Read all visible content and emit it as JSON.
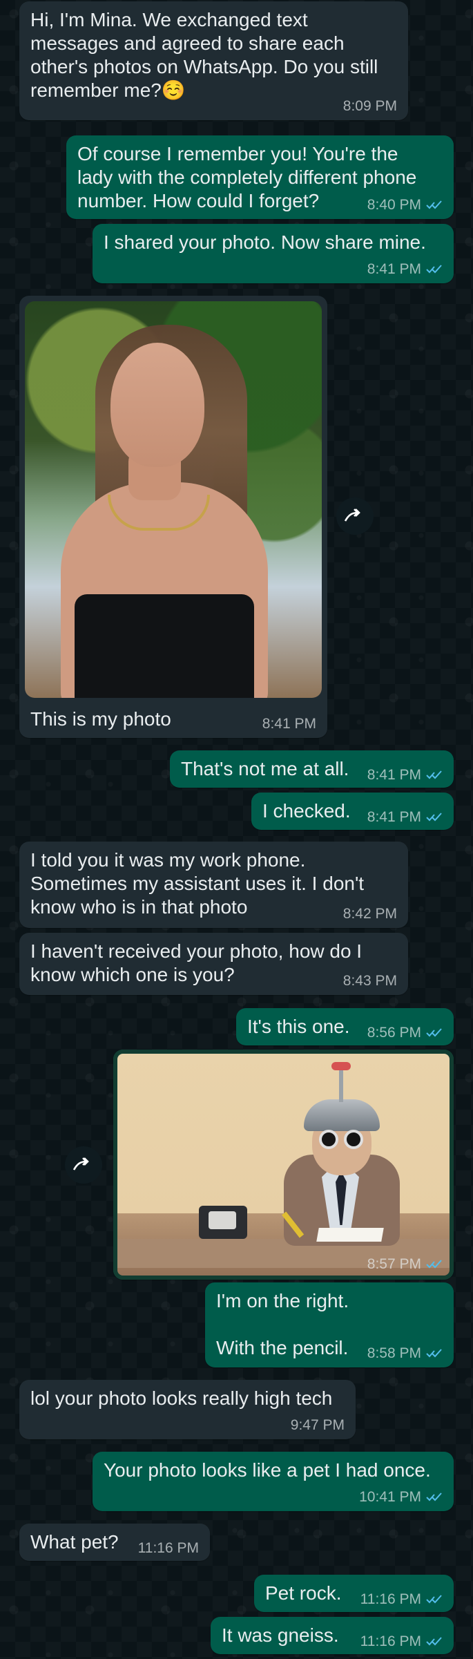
{
  "messages": [
    {
      "text": "Hi, I'm Mina. We exchanged text\nmessages and agreed to share each\nother's photos on WhatsApp. Do you still\nremember me?☺️",
      "time": "8:09 PM"
    },
    {
      "text": "Of course I remember you!  You're the\nlady with the completely different phone\nnumber.  How could I forget?",
      "time": "8:40 PM"
    },
    {
      "text": "I shared your photo.  Now share mine.",
      "time": "8:41 PM"
    },
    {
      "caption": "This is my photo",
      "time": "8:41 PM"
    },
    {
      "text": "That's not me at all.",
      "time": "8:41 PM"
    },
    {
      "text": "I checked.",
      "time": "8:41 PM"
    },
    {
      "text": "I told you it was my work phone.\nSometimes my assistant uses it. I don't\nknow who is in that photo",
      "time": "8:42 PM"
    },
    {
      "text": "I haven't received your photo, how do I\nknow which one is you?",
      "time": "8:43 PM"
    },
    {
      "text": "It's this one.",
      "time": "8:56 PM"
    },
    {
      "time": "8:57 PM"
    },
    {
      "text": "I'm on the right.\n\nWith the pencil.",
      "time": "8:58 PM"
    },
    {
      "text": "lol your photo looks really high tech",
      "time": "9:47 PM"
    },
    {
      "text": "Your photo looks like a pet I had once.",
      "time": "10:41 PM"
    },
    {
      "text": "What pet?",
      "time": "11:16 PM"
    },
    {
      "text": "Pet rock.",
      "time": "11:16 PM"
    },
    {
      "text": "It was gneiss.",
      "time": "11:16 PM"
    }
  ],
  "icons": {
    "forward": "forward-icon",
    "read_receipt": "double-check-icon"
  },
  "colors": {
    "incoming_bubble": "#202c33",
    "outgoing_bubble": "#005c4b",
    "read_tick": "#53bdeb"
  }
}
